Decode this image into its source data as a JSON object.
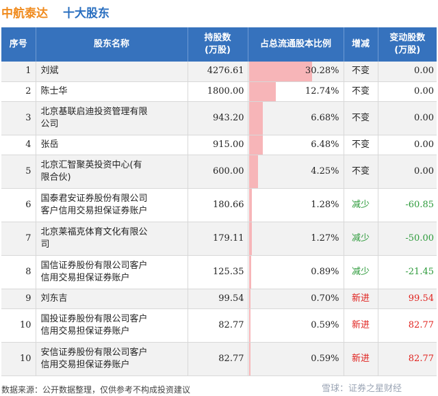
{
  "header": {
    "company": "中航泰达",
    "topic": "十大股东"
  },
  "columns": {
    "index": "序号",
    "name": "股东名称",
    "shares_line1": "持股数",
    "shares_line2": "(万股)",
    "ratio": "占总流通股本比例",
    "change": "增减",
    "delta_line1": "变动股数",
    "delta_line2": "(万股)"
  },
  "colors": {
    "header_bg": "#3672bd",
    "bar": "#f7b5b8",
    "increase_status": "#e0201c",
    "decrease_status": "#2c9a3a",
    "company_title": "#f08a1c",
    "topic_title": "#2a6fc0"
  },
  "rows": [
    {
      "index": "1",
      "name_line1": "刘斌",
      "name_line2": "",
      "shares": "4276.61",
      "ratio": "30.28%",
      "ratio_value": 30.28,
      "change": "不变",
      "status": "same",
      "delta": "0.00"
    },
    {
      "index": "2",
      "name_line1": "陈士华",
      "name_line2": "",
      "shares": "1800.00",
      "ratio": "12.74%",
      "ratio_value": 12.74,
      "change": "不变",
      "status": "same",
      "delta": "0.00"
    },
    {
      "index": "3",
      "name_line1": "北京基联启迪投资管理有限",
      "name_line2": "公司",
      "shares": "943.20",
      "ratio": "6.68%",
      "ratio_value": 6.68,
      "change": "不变",
      "status": "same",
      "delta": "0.00"
    },
    {
      "index": "4",
      "name_line1": "张岳",
      "name_line2": "",
      "shares": "915.00",
      "ratio": "6.48%",
      "ratio_value": 6.48,
      "change": "不变",
      "status": "same",
      "delta": "0.00"
    },
    {
      "index": "5",
      "name_line1": "北京汇智聚英投资中心(有",
      "name_line2": "限合伙)",
      "shares": "600.00",
      "ratio": "4.25%",
      "ratio_value": 4.25,
      "change": "不变",
      "status": "same",
      "delta": "0.00"
    },
    {
      "index": "6",
      "name_line1": "国泰君安证券股份有限公司",
      "name_line2": "客户信用交易担保证券账户",
      "shares": "180.66",
      "ratio": "1.28%",
      "ratio_value": 1.28,
      "change": "减少",
      "status": "down",
      "delta": "-60.85"
    },
    {
      "index": "7",
      "name_line1": "北京莱福克体育文化有限公",
      "name_line2": "司",
      "shares": "179.11",
      "ratio": "1.27%",
      "ratio_value": 1.27,
      "change": "减少",
      "status": "down",
      "delta": "-50.00"
    },
    {
      "index": "8",
      "name_line1": "国信证券股份有限公司客户",
      "name_line2": "信用交易担保证券账户",
      "shares": "125.35",
      "ratio": "0.89%",
      "ratio_value": 0.89,
      "change": "减少",
      "status": "down",
      "delta": "-21.45"
    },
    {
      "index": "9",
      "name_line1": "刘东吉",
      "name_line2": "",
      "shares": "99.54",
      "ratio": "0.70%",
      "ratio_value": 0.7,
      "change": "新进",
      "status": "new",
      "delta": "99.54"
    },
    {
      "index": "10",
      "name_line1": "国投证券股份有限公司客户",
      "name_line2": "信用交易担保证券账户",
      "shares": "82.77",
      "ratio": "0.59%",
      "ratio_value": 0.59,
      "change": "新进",
      "status": "new",
      "delta": "82.77"
    },
    {
      "index": "10",
      "name_line1": "安信证券股份有限公司客户",
      "name_line2": "信用交易担保证券账户",
      "shares": "82.77",
      "ratio": "0.59%",
      "ratio_value": 0.59,
      "change": "新进",
      "status": "new",
      "delta": "82.77"
    }
  ],
  "footer": {
    "source": "数据来源：公开数据整理，仅供参考不构成投资建议",
    "brand": "雪球：证券之星财经"
  }
}
